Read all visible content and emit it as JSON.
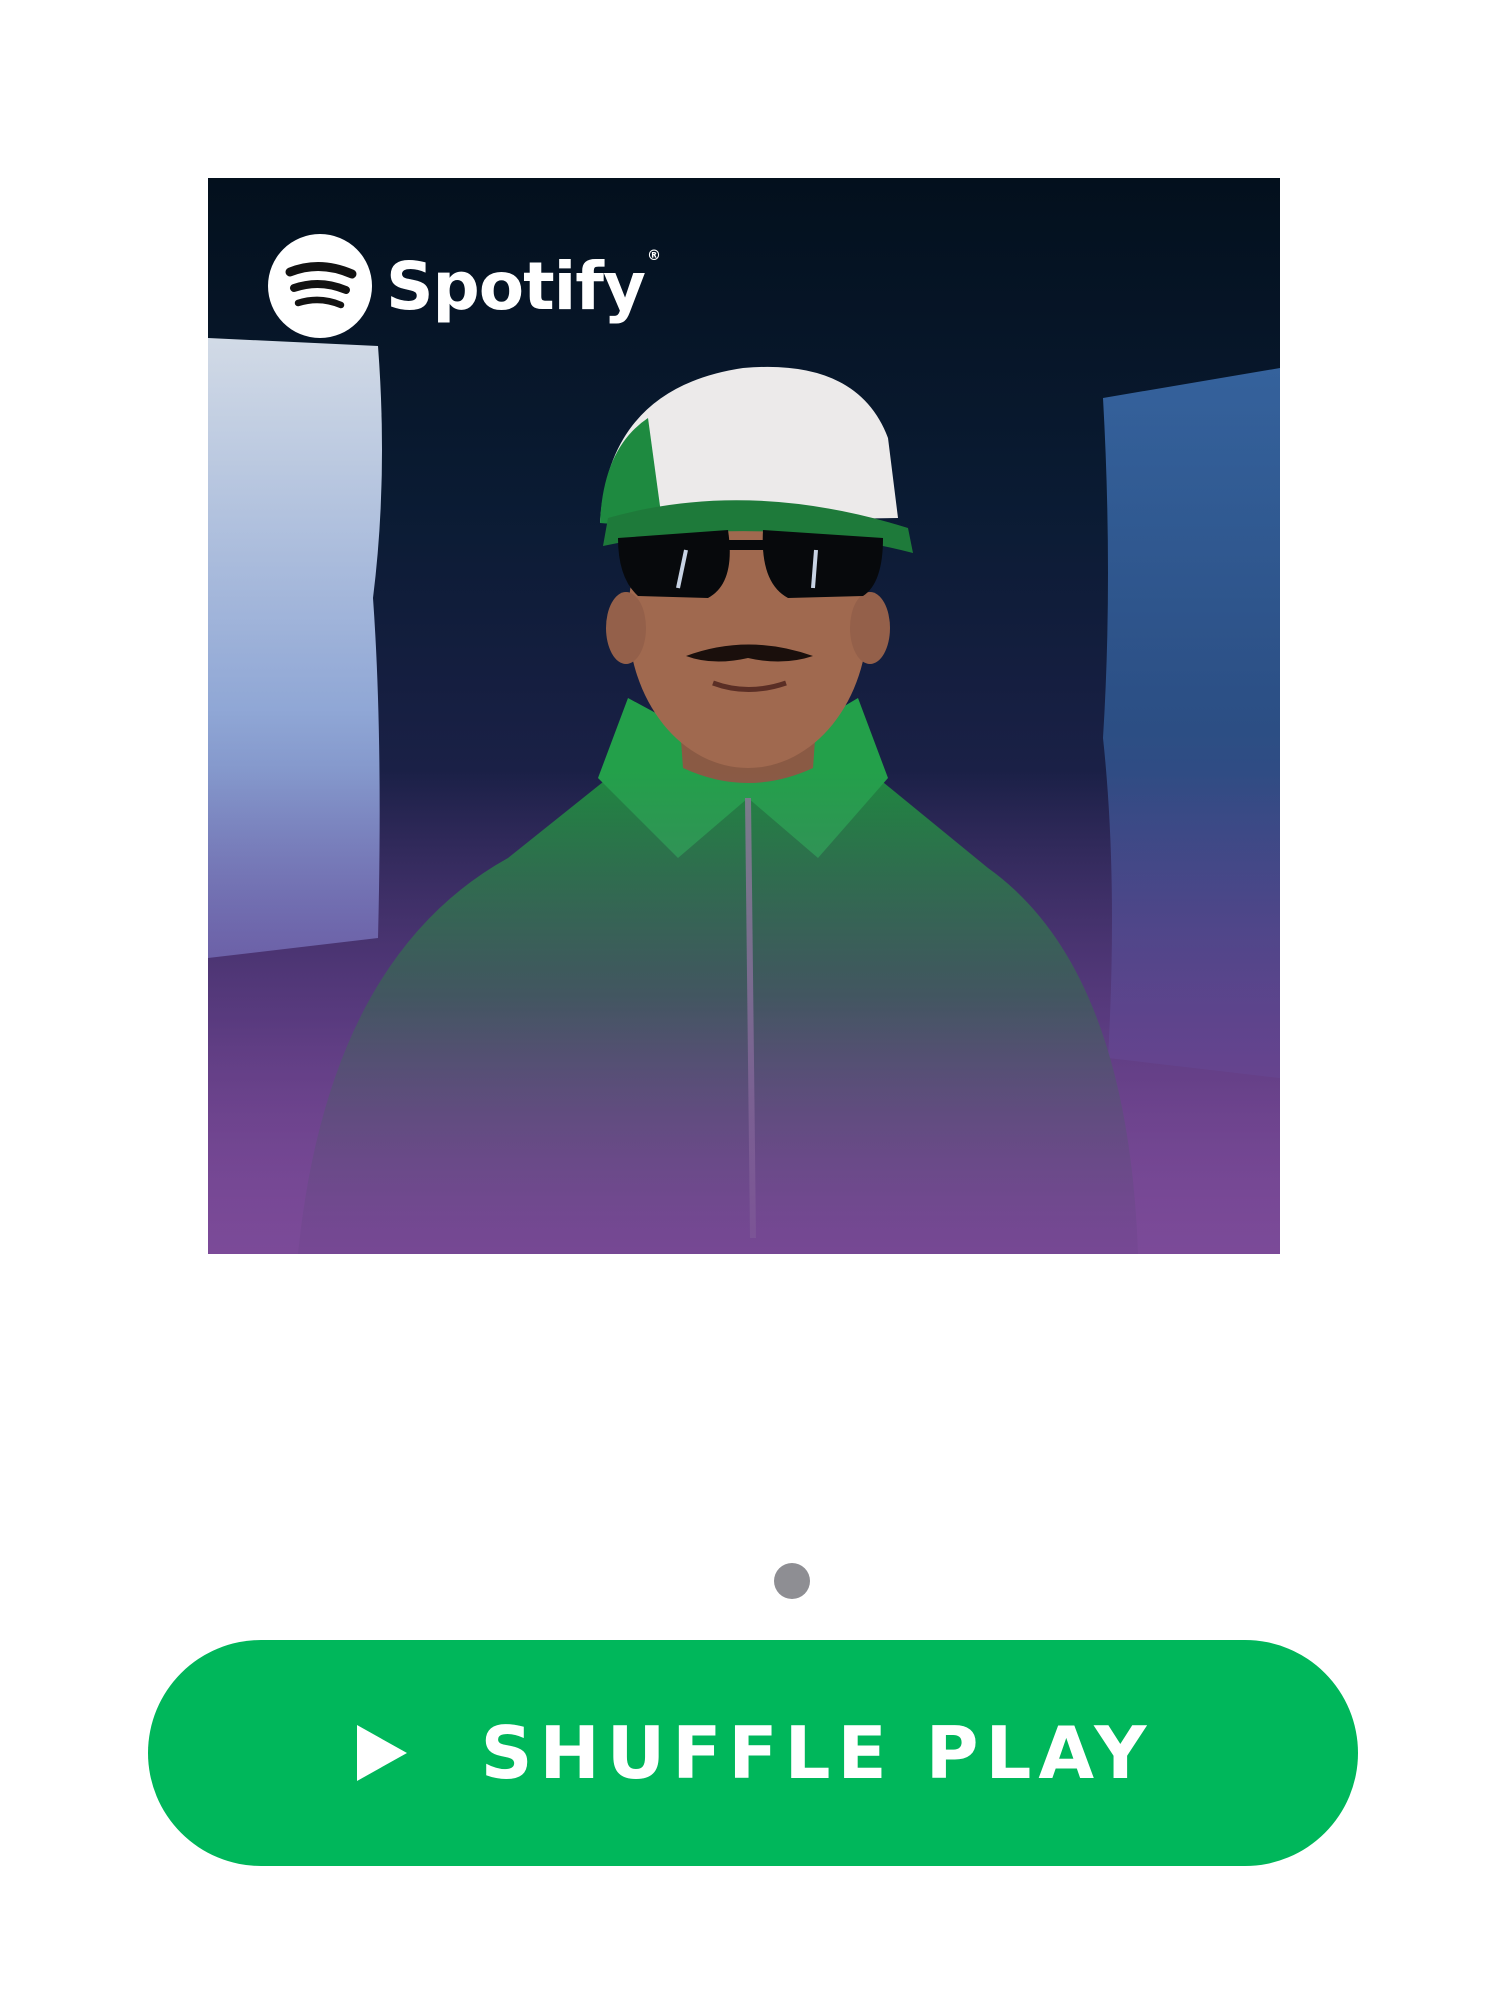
{
  "cover": {
    "brand_icon": "spotify-logo-icon",
    "brand_name": "Spotify",
    "brand_mark": "®",
    "artwork_description_icon": "artist-photo"
  },
  "pager": {
    "active_index": 0,
    "total": 1,
    "color": "#8e8e93"
  },
  "shuffle_button": {
    "label": "SHUFFLE PLAY",
    "icon": "play-icon",
    "color": "#00b75b"
  }
}
